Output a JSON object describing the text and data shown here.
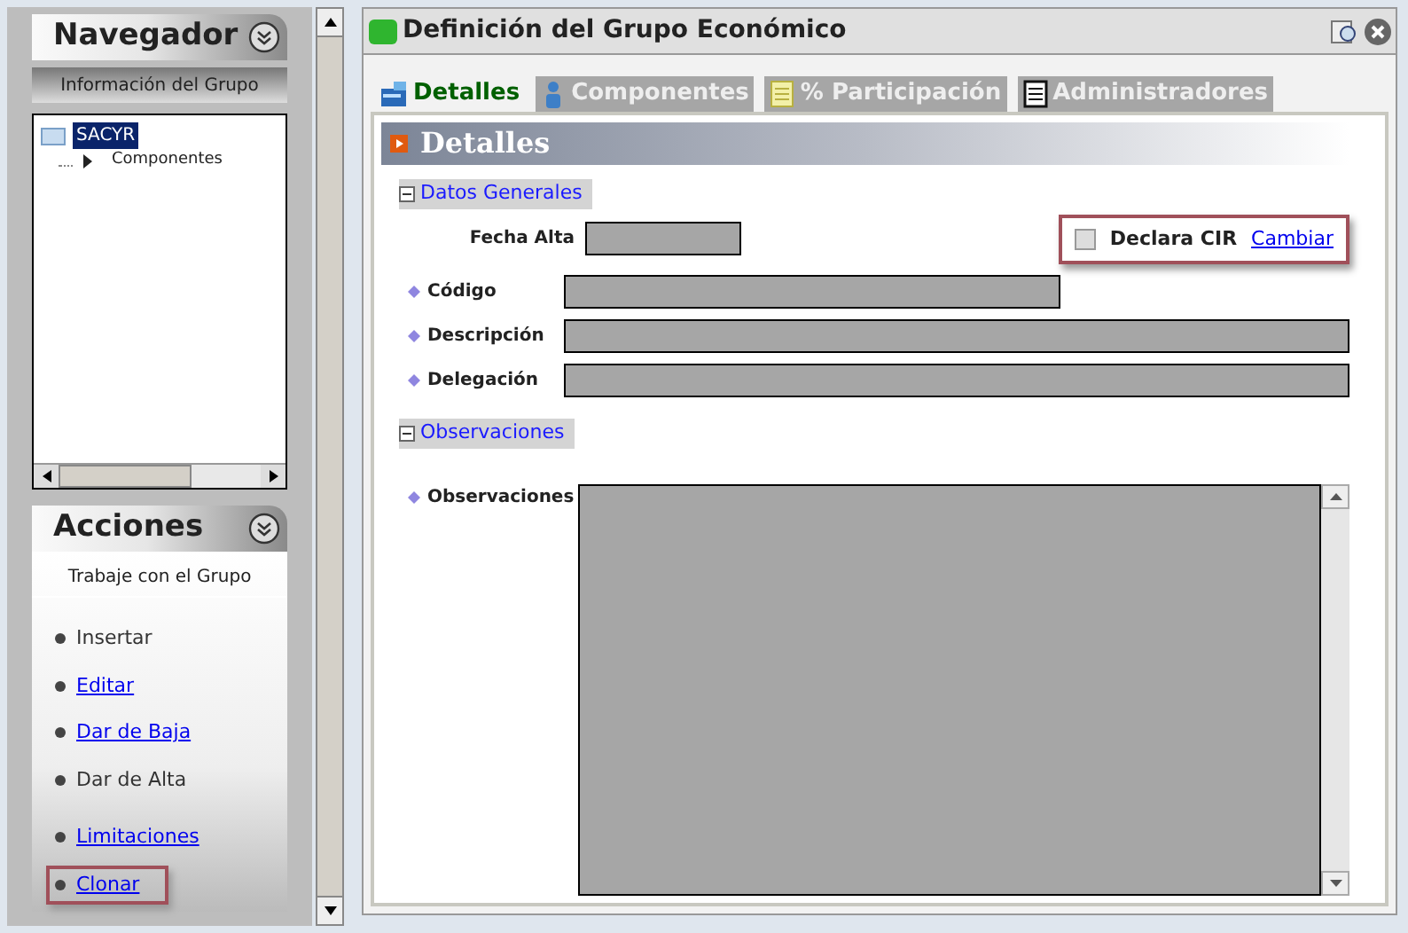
{
  "navigator": {
    "title": "Navegador",
    "subtitle": "Información del Grupo",
    "tree": [
      {
        "label": "SACYR",
        "selected": true,
        "expanded": true,
        "children": [
          {
            "label": "Componentes",
            "expanded": false
          }
        ]
      }
    ]
  },
  "actions": {
    "title": "Acciones",
    "subtitle": "Trabaje con el Grupo",
    "items": [
      {
        "label": "Insertar",
        "kind": "text",
        "highlighted": false
      },
      {
        "label": "Editar",
        "kind": "link",
        "highlighted": false
      },
      {
        "label": "Dar de Baja",
        "kind": "link",
        "highlighted": false
      },
      {
        "label": "Dar de Alta",
        "kind": "text",
        "highlighted": false
      },
      {
        "label": "Limitaciones",
        "kind": "link",
        "highlighted": false
      },
      {
        "label": "Clonar",
        "kind": "link",
        "highlighted": true
      }
    ]
  },
  "window": {
    "title": "Definición del Grupo Económico",
    "tabs": [
      {
        "label": "Detalles",
        "selected": true
      },
      {
        "label": "Componentes",
        "selected": false
      },
      {
        "label": "% Participación",
        "selected": false
      },
      {
        "label": "Administradores",
        "selected": false
      }
    ],
    "section_title": "Detalles",
    "general": {
      "title": "Datos Generales",
      "expanded": true,
      "fields": [
        {
          "label": "Fecha Alta",
          "required": false,
          "kind": "short"
        },
        {
          "label": "Código",
          "required": true,
          "kind": "medium"
        },
        {
          "label": "Descripción",
          "required": true,
          "kind": "full"
        },
        {
          "label": "Delegación",
          "required": true,
          "kind": "full"
        }
      ],
      "declara": {
        "label": "Declara CIR",
        "checked": false,
        "link": "Cambiar",
        "highlighted": true
      }
    },
    "notes": {
      "title": "Observaciones",
      "expanded": true,
      "field": {
        "label": "Observaciones",
        "required": true
      }
    }
  }
}
